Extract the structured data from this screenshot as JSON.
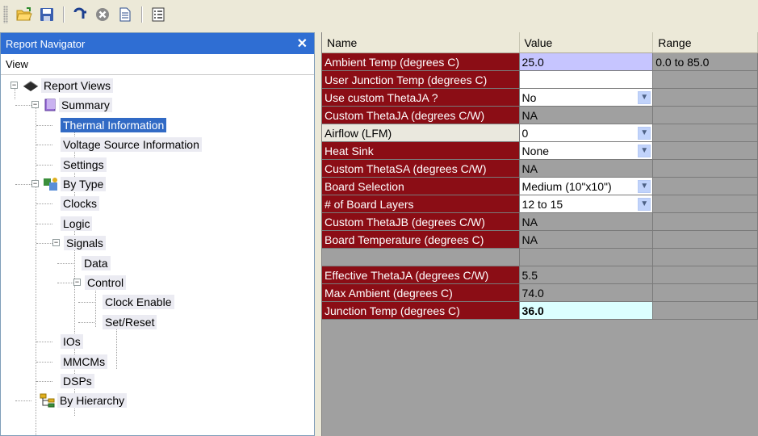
{
  "toolbar": {
    "buttons": [
      {
        "icon": "open-folder-icon"
      },
      {
        "icon": "save-disk-icon"
      },
      {
        "icon": "tuning-fork-icon"
      },
      {
        "icon": "cancel-circle-icon"
      },
      {
        "icon": "document-icon"
      },
      {
        "icon": "report-list-icon"
      }
    ]
  },
  "navigator": {
    "title": "Report Navigator",
    "close_label": "✕",
    "column_header": "View",
    "tree": [
      {
        "label": "Report Views",
        "icon": "chip-icon",
        "level": 0,
        "expander": "−"
      },
      {
        "label": "Summary",
        "icon": "book-icon",
        "level": 1,
        "expander": "−"
      },
      {
        "label": "Thermal Information",
        "level": 2,
        "selected": true
      },
      {
        "label": "Voltage Source Information",
        "level": 2
      },
      {
        "label": "Settings",
        "level": 2
      },
      {
        "label": "By Type",
        "icon": "types-icon",
        "level": 1,
        "expander": "−"
      },
      {
        "label": "Clocks",
        "level": 2
      },
      {
        "label": "Logic",
        "level": 2
      },
      {
        "label": "Signals",
        "level": 2,
        "expander": "−"
      },
      {
        "label": "Data",
        "level": 3
      },
      {
        "label": "Control",
        "level": 3,
        "expander": "−"
      },
      {
        "label": "Clock Enable",
        "level": 4
      },
      {
        "label": "Set/Reset",
        "level": 4
      },
      {
        "label": "IOs",
        "level": 2
      },
      {
        "label": "MMCMs",
        "level": 2
      },
      {
        "label": "DSPs",
        "level": 2
      },
      {
        "label": "By Hierarchy",
        "icon": "hierarchy-icon",
        "level": 1
      }
    ]
  },
  "grid": {
    "headers": {
      "name": "Name",
      "value": "Value",
      "range": "Range"
    },
    "rows": [
      {
        "name": "Ambient Temp (degrees C)",
        "value": "25.0",
        "range": "0.0 to 85.0",
        "name_style": "red",
        "value_style": "lav",
        "range_style": "grey"
      },
      {
        "name": "User Junction Temp (degrees C)",
        "value": "",
        "range": "",
        "name_style": "red",
        "value_style": "white",
        "range_style": "grey"
      },
      {
        "name": "Use custom ThetaJA ?",
        "value": "No",
        "range": "",
        "name_style": "red",
        "value_style": "white",
        "range_style": "grey",
        "dropdown": true
      },
      {
        "name": "Custom ThetaJA (degrees C/W)",
        "value": "NA",
        "range": "",
        "name_style": "red",
        "value_style": "grey",
        "range_style": "grey"
      },
      {
        "name": "Airflow (LFM)",
        "value": "0",
        "range": "",
        "name_style": "plain",
        "value_style": "white",
        "range_style": "grey",
        "dropdown": true
      },
      {
        "name": "Heat Sink",
        "value": "None",
        "range": "",
        "name_style": "red",
        "value_style": "white",
        "range_style": "grey",
        "dropdown": true
      },
      {
        "name": "Custom ThetaSA (degrees C/W)",
        "value": "NA",
        "range": "",
        "name_style": "red",
        "value_style": "grey",
        "range_style": "grey"
      },
      {
        "name": "Board Selection",
        "value": "Medium (10\"x10\")",
        "range": "",
        "name_style": "red",
        "value_style": "white",
        "range_style": "grey",
        "dropdown": true
      },
      {
        "name": "# of Board Layers",
        "value": "12 to 15",
        "range": "",
        "name_style": "red",
        "value_style": "white",
        "range_style": "grey",
        "dropdown": true
      },
      {
        "name": "Custom ThetaJB (degrees C/W)",
        "value": "NA",
        "range": "",
        "name_style": "red",
        "value_style": "grey",
        "range_style": "grey"
      },
      {
        "name": "Board Temperature (degrees C)",
        "value": "NA",
        "range": "",
        "name_style": "red",
        "value_style": "grey",
        "range_style": "grey"
      },
      {
        "name": "",
        "value": "",
        "range": "",
        "name_style": "empty",
        "value_style": "grey",
        "range_style": "grey"
      },
      {
        "name": "Effective ThetaJA (degrees C/W)",
        "value": "5.5",
        "range": "",
        "name_style": "red",
        "value_style": "grey",
        "range_style": "grey"
      },
      {
        "name": "Max Ambient (degrees C)",
        "value": "74.0",
        "range": "",
        "name_style": "red",
        "value_style": "grey",
        "range_style": "grey"
      },
      {
        "name": "Junction Temp (degrees C)",
        "value": "36.0",
        "range": "",
        "name_style": "red",
        "value_style": "cyan",
        "range_style": "grey"
      }
    ]
  },
  "colors": {
    "title_bar": "#2f6ed3",
    "selected": "#316ac5",
    "name_red": "#8b0d15",
    "value_highlight": "#c6c5ff",
    "result_highlight": "#dcffff",
    "grid_bg": "#a0a0a0"
  }
}
